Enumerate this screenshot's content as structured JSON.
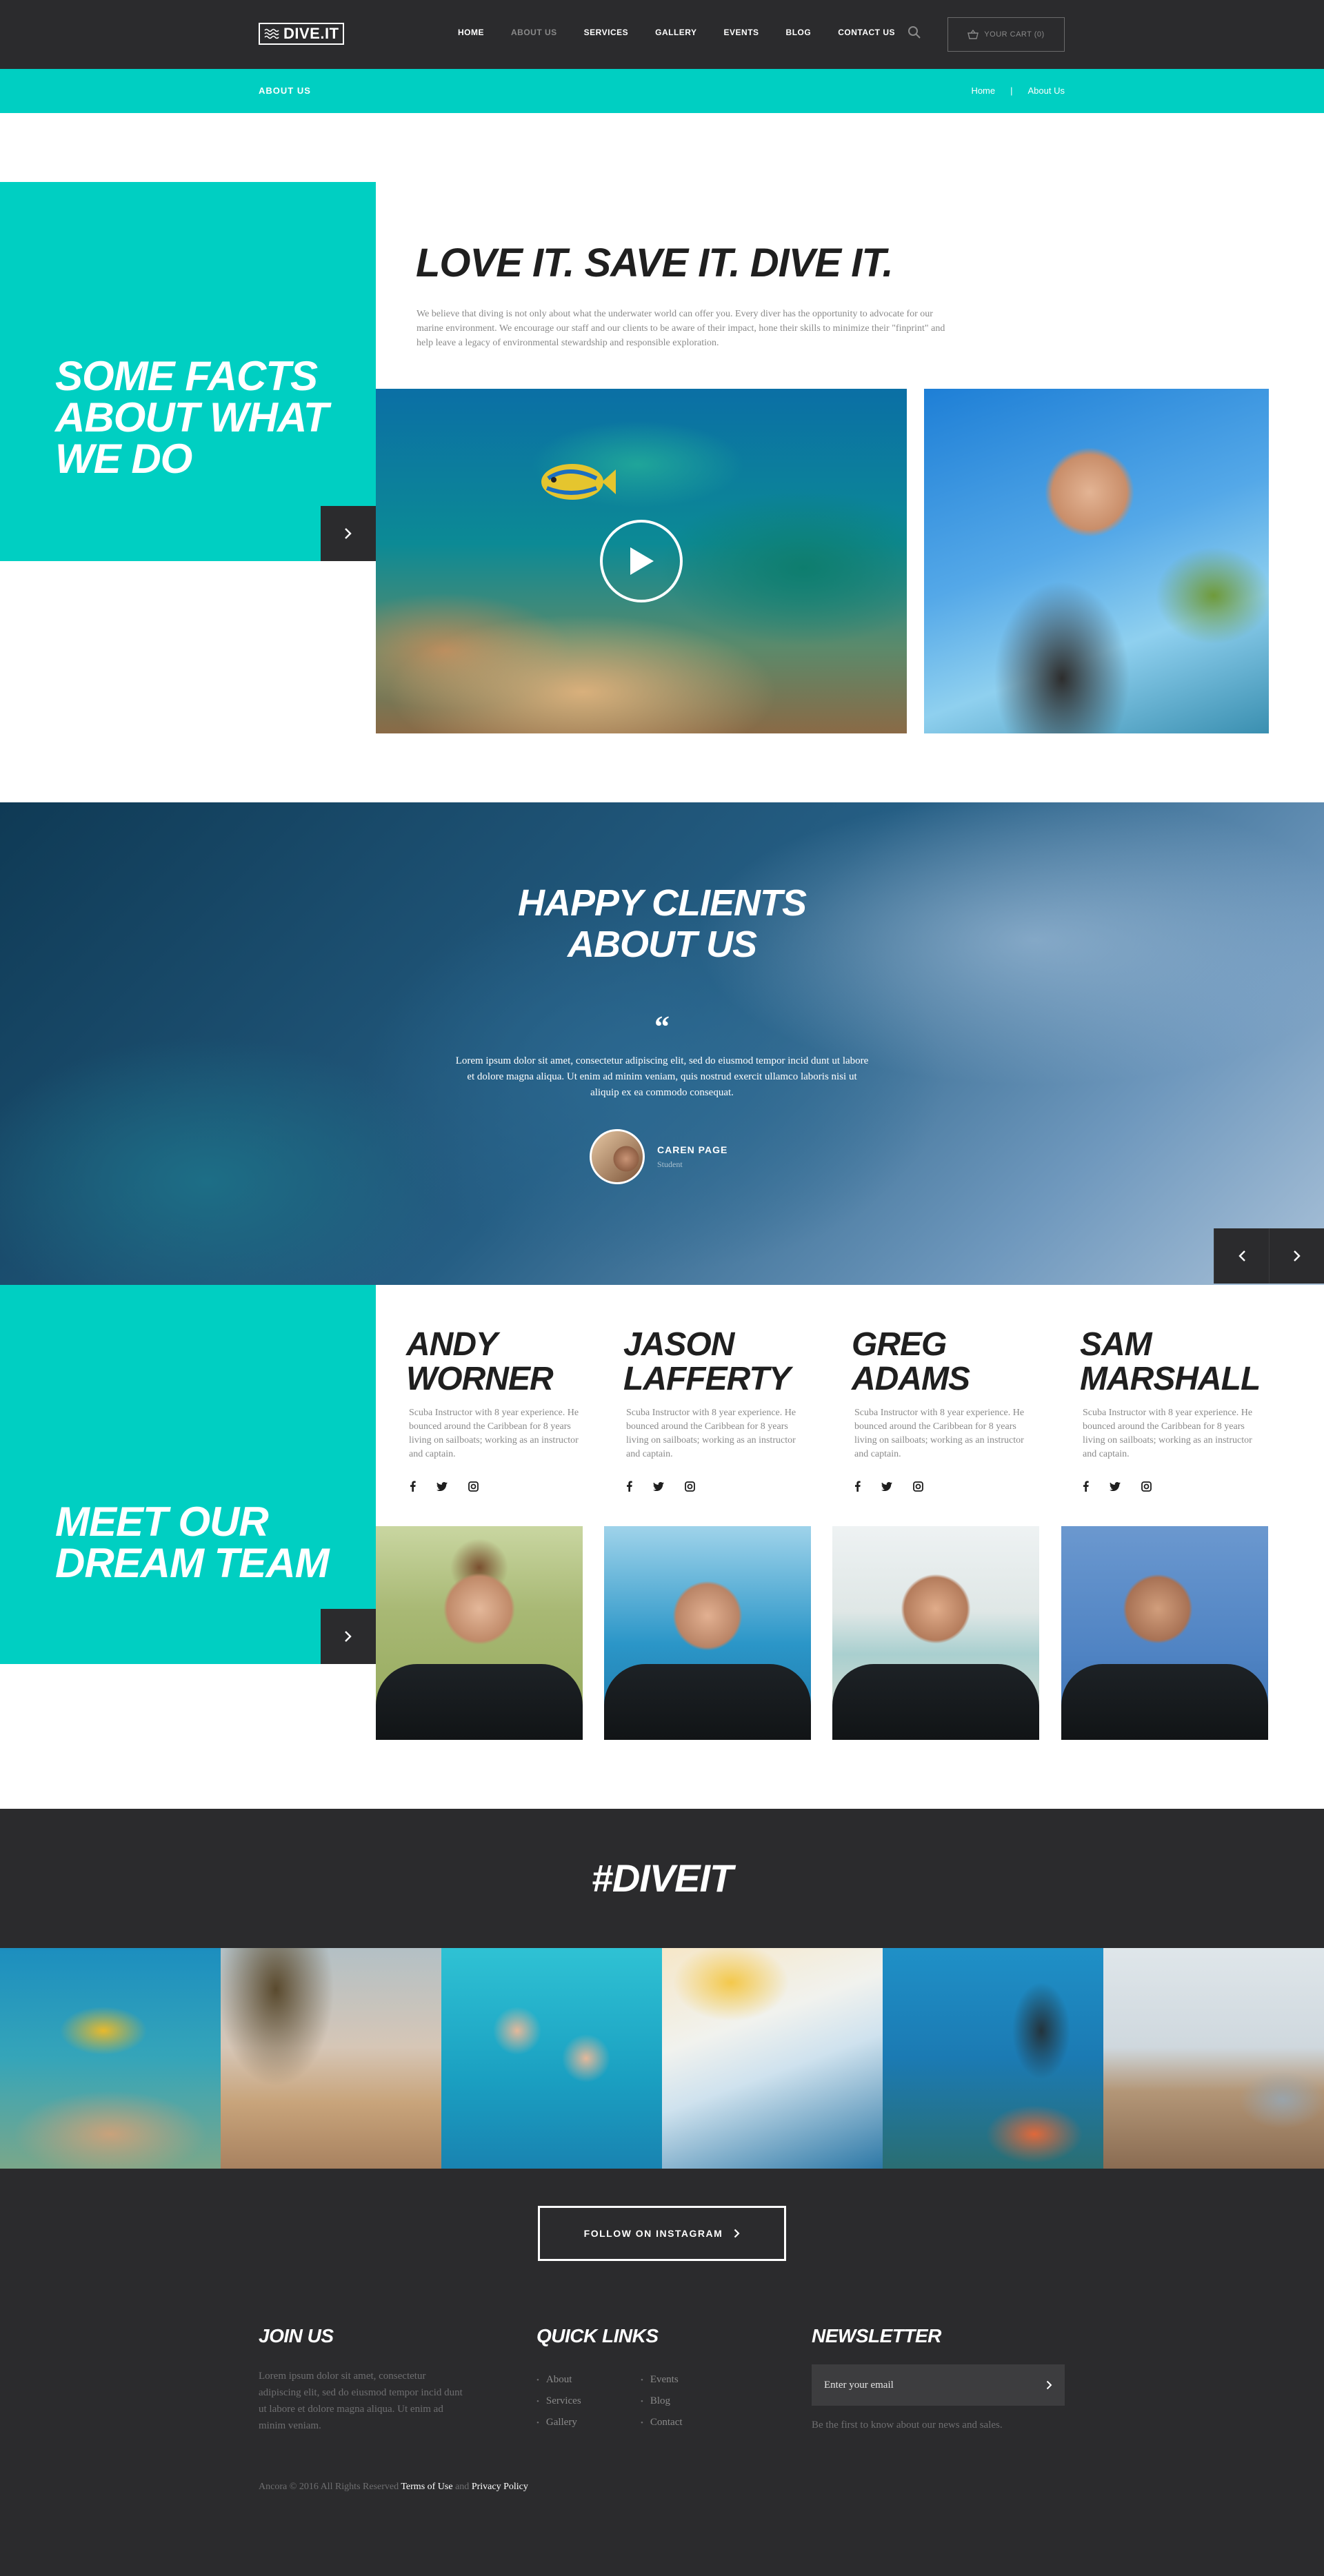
{
  "header": {
    "logo": "DIVE.IT",
    "nav": [
      "HOME",
      "ABOUT US",
      "SERVICES",
      "GALLERY",
      "EVENTS",
      "BLOG",
      "CONTACT US"
    ],
    "active_nav": "ABOUT US",
    "cart": "YOUR CART (0)"
  },
  "subbar": {
    "title": "ABOUT US",
    "crumbs": [
      "Home",
      "|",
      "About Us"
    ]
  },
  "facts": {
    "title_lines": [
      "SOME FACTS",
      "ABOUT WHAT",
      "WE DO"
    ],
    "heading": "LOVE IT. SAVE IT. DIVE IT.",
    "text": "We believe that diving is not only about what the underwater world can offer you.  Every diver has the opportunity to advocate for our marine environment.  We encourage our staff and our clients to be aware of their impact, hone their skills to minimize their \"finprint\" and help leave a legacy of environmental stewardship and responsible exploration."
  },
  "clients": {
    "title_lines": [
      "HAPPY CLIENTS",
      "ABOUT US"
    ],
    "quote_mark": "“",
    "quote": "Lorem ipsum dolor sit amet, consectetur adipiscing elit, sed do eiusmod tempor incid dunt ut labore et dolore magna aliqua. Ut enim ad minim veniam, quis nostrud exercit ullamco laboris nisi ut aliquip ex ea commodo consequat.",
    "author": "CAREN PAGE",
    "role": "Student"
  },
  "team": {
    "title_lines": [
      "MEET OUR",
      "DREAM TEAM"
    ],
    "members": [
      {
        "first": "ANDY",
        "last": "WORNER",
        "bio": "Scuba Instructor with 8 year experience. He bounced around the Caribbean for 8 years living on sailboats; working as an instructor and captain."
      },
      {
        "first": "JASON",
        "last": "LAFFERTY",
        "bio": "Scuba Instructor with 8 year experience. He bounced around the Caribbean for 8 years living on sailboats; working as an instructor and captain."
      },
      {
        "first": "GREG",
        "last": "ADAMS",
        "bio": "Scuba Instructor with 8 year experience. He bounced around the Caribbean for 8 years living on sailboats; working as an instructor and captain."
      },
      {
        "first": "SAM",
        "last": "MARSHALL",
        "bio": "Scuba Instructor with 8 year experience. He bounced around the Caribbean for 8 years living on sailboats; working as an instructor and captain."
      }
    ]
  },
  "instagram": {
    "title": "#DIVEIT",
    "follow": "FOLLOW ON INSTAGRAM"
  },
  "footer": {
    "join_title": "JOIN US",
    "join_text": "Lorem ipsum dolor sit amet, consectetur adipiscing elit, sed do eiusmod tempor incid dunt ut labore et dolore magna aliqua. Ut enim ad minim veniam.",
    "links_title": "QUICK LINKS",
    "links_col1": [
      "About",
      "Services",
      "Gallery"
    ],
    "links_col2": [
      "Events",
      "Blog",
      "Contact"
    ],
    "news_title": "NEWSLETTER",
    "email_placeholder": "Enter your email",
    "news_note": "Be the first to know about our news and sales.",
    "copyright_prefix": "Ancora © 2016 All Rights Reserved",
    "terms": "Terms of Use",
    "and": "and",
    "privacy": "Privacy Policy"
  },
  "colors": {
    "accent": "#00cfc2",
    "dark": "#2b2b2d"
  }
}
